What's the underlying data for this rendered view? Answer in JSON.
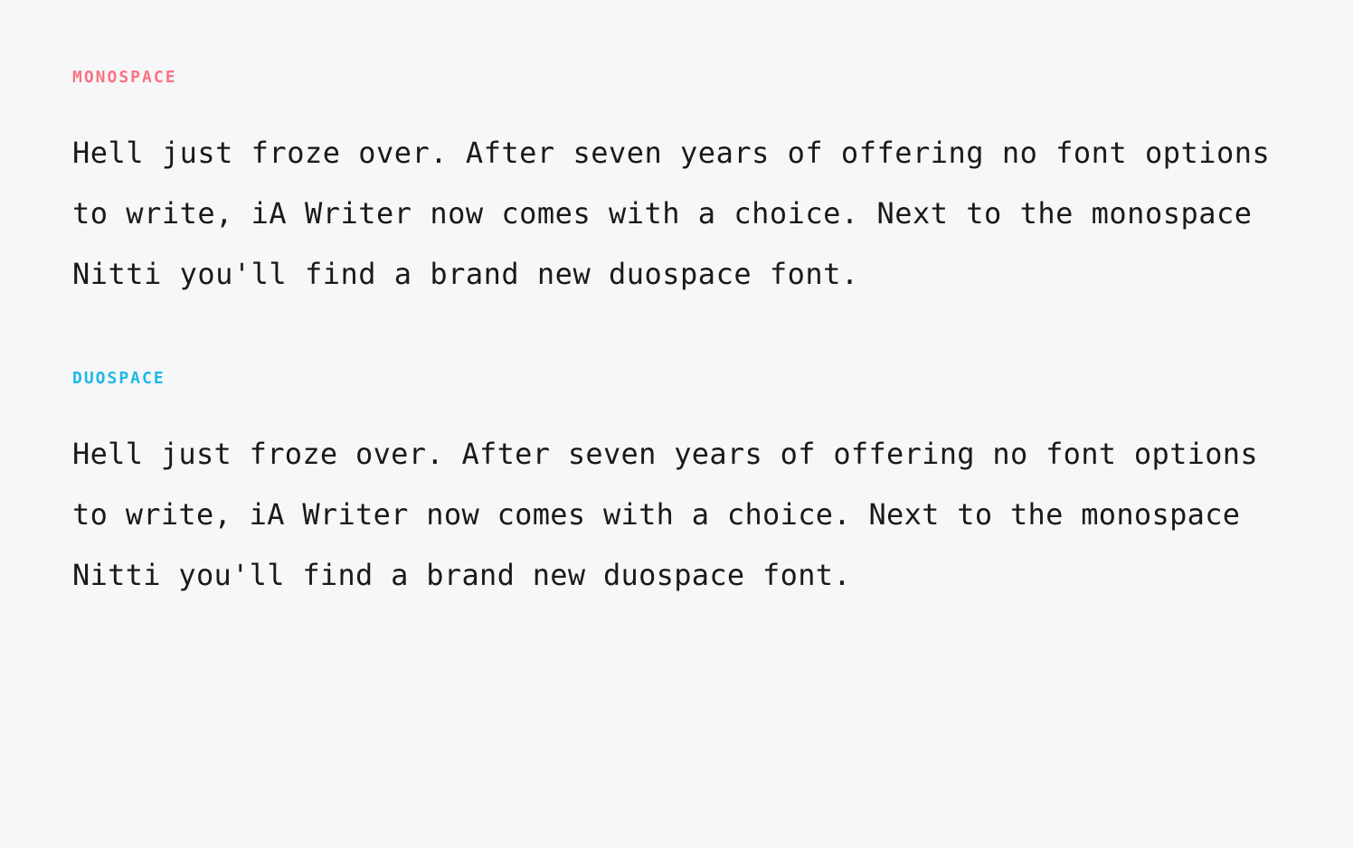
{
  "sections": [
    {
      "label": "MONOSPACE",
      "label_color": "#f97383",
      "body": "Hell just froze over. After seven years of offering no font options to write, iA Writer now comes with a choice. Next to the monospace Nitti you'll find a brand new duospace font."
    },
    {
      "label": "DUOSPACE",
      "label_color": "#1eb8e8",
      "body": "Hell just froze over. After seven years of offering no font options to write, iA Writer now comes with a choice. Next to the monospace Nitti you'll find a brand new duospace font."
    }
  ]
}
